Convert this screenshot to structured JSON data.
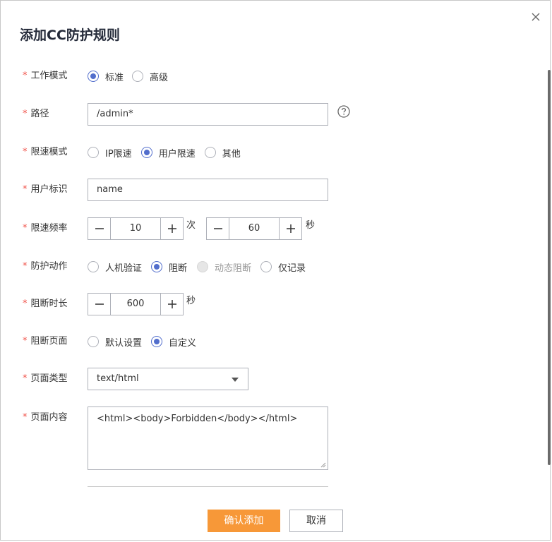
{
  "dialog": {
    "title": "添加CC防护规则"
  },
  "form": {
    "required_mark": "*",
    "work_mode": {
      "label": "工作模式",
      "options": [
        {
          "label": "标准",
          "checked": true
        },
        {
          "label": "高级",
          "checked": false
        }
      ]
    },
    "path": {
      "label": "路径",
      "value": "/admin*",
      "help_icon": "question-circle-icon"
    },
    "rate_limit_mode": {
      "label": "限速模式",
      "options": [
        {
          "label": "IP限速",
          "checked": false
        },
        {
          "label": "用户限速",
          "checked": true
        },
        {
          "label": "其他",
          "checked": false
        }
      ]
    },
    "user_id": {
      "label": "用户标识",
      "value": "name"
    },
    "rate_frequency": {
      "label": "限速频率",
      "count_value": "10",
      "count_unit": "次",
      "period_value": "60",
      "period_unit": "秒"
    },
    "protection_action": {
      "label": "防护动作",
      "options": [
        {
          "label": "人机验证",
          "checked": false,
          "disabled": false
        },
        {
          "label": "阻断",
          "checked": true,
          "disabled": false
        },
        {
          "label": "动态阻断",
          "checked": false,
          "disabled": true
        },
        {
          "label": "仅记录",
          "checked": false,
          "disabled": false
        }
      ]
    },
    "block_duration": {
      "label": "阻断时长",
      "value": "600",
      "unit": "秒"
    },
    "block_page": {
      "label": "阻断页面",
      "options": [
        {
          "label": "默认设置",
          "checked": false
        },
        {
          "label": "自定义",
          "checked": true
        }
      ]
    },
    "page_type": {
      "label": "页面类型",
      "value": "text/html"
    },
    "page_content": {
      "label": "页面内容",
      "value": "<html><body>Forbidden</body></html>"
    }
  },
  "footer": {
    "confirm_label": "确认添加",
    "cancel_label": "取消"
  },
  "colors": {
    "accent": "#526ecc",
    "primary_button": "#f79838",
    "required": "#f0534a"
  }
}
